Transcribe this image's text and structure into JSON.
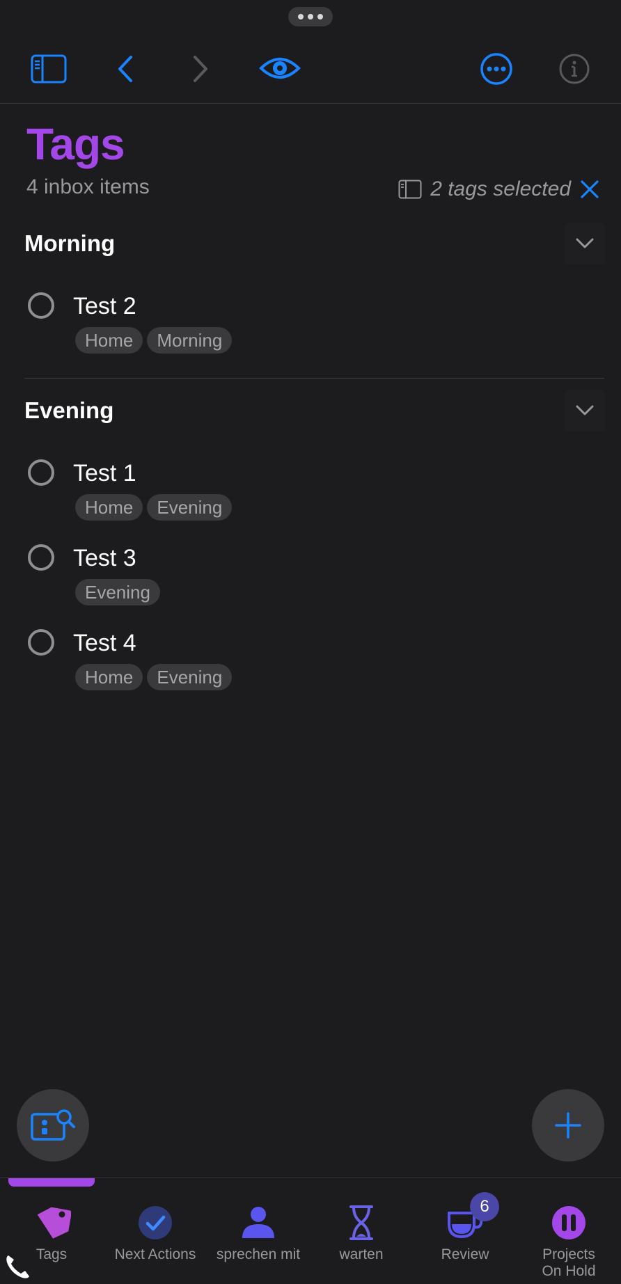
{
  "header": {
    "title": "Tags",
    "subtitle": "4 inbox items",
    "tags_selected": "2 tags selected"
  },
  "toolbar": {
    "icons": [
      "sidebar-icon",
      "back-chevron-icon",
      "forward-chevron-icon",
      "eye-icon",
      "more-circle-icon",
      "info-icon"
    ]
  },
  "sections": [
    {
      "title": "Morning",
      "tasks": [
        {
          "title": "Test 2",
          "tags": [
            "Home",
            "Morning"
          ]
        }
      ]
    },
    {
      "title": "Evening",
      "tasks": [
        {
          "title": "Test 1",
          "tags": [
            "Home",
            "Evening"
          ]
        },
        {
          "title": "Test 3",
          "tags": [
            "Evening"
          ]
        },
        {
          "title": "Test 4",
          "tags": [
            "Home",
            "Evening"
          ]
        }
      ]
    }
  ],
  "tabbar": {
    "tabs": [
      {
        "label": "Tags",
        "icon": "tag-icon",
        "active": true
      },
      {
        "label": "Next Actions",
        "icon": "checkmark-circle-icon"
      },
      {
        "label": "sprechen mit",
        "icon": "person-icon"
      },
      {
        "label": "warten",
        "icon": "hourglass-icon"
      },
      {
        "label": "Review",
        "icon": "cup-icon",
        "badge": "6"
      },
      {
        "label": "Projects\nOn Hold",
        "icon": "pause-circle-icon"
      }
    ]
  },
  "colors": {
    "accent_purple": "#a347e8",
    "tint_blue": "#1a84ff",
    "background": "#1c1c1e",
    "chip_background": "#3a3a3c"
  }
}
